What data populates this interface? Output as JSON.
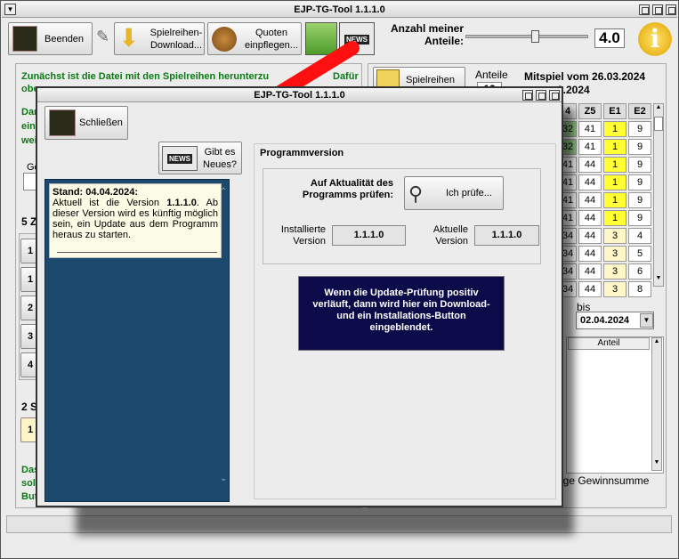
{
  "app": {
    "title": "EJP-TG-Tool 1.1.1.0"
  },
  "toolbar": {
    "quit_label": "Beenden",
    "download_label": "Spielreihen-\nDownload...",
    "quotes_label": "Quoten\neinpflegen...",
    "shares_label": "Anzahl meiner\nAnteile:",
    "shares_value": "4.0",
    "shares_slider": 0.55
  },
  "main": {
    "intro_text": "Zunächst ist die Datei mit den Spielreihen herunterzu",
    "intro_text2": "obe",
    "intro_tail": "Dafür",
    "intro2_lines": [
      "Dar",
      "ein",
      "wei"
    ],
    "ge_label": "Ge",
    "five_label": "5 Z",
    "rows": [
      "1",
      "1",
      "2",
      "3",
      "4"
    ],
    "two_label": "2 S",
    "two_row": "1",
    "bottom_lines": [
      "Das",
      "sola",
      "But"
    ],
    "spielreihen_label": "Spielreihen",
    "anteile_label": "Anteile",
    "anteile_value": "12",
    "mitspiel_label": "Mitspiel vom 26.03.2024",
    "mitspiel_to": "2.2024",
    "grid_headers": [
      "4",
      "Z5",
      "E1",
      "E2"
    ],
    "grid_rows": [
      [
        "32",
        "41",
        "1",
        "9"
      ],
      [
        "32",
        "41",
        "1",
        "9"
      ],
      [
        "41",
        "44",
        "1",
        "9"
      ],
      [
        "41",
        "44",
        "1",
        "9"
      ],
      [
        "41",
        "44",
        "1",
        "9"
      ],
      [
        "41",
        "44",
        "1",
        "9"
      ],
      [
        "34",
        "44",
        "3",
        "4"
      ],
      [
        "34",
        "44",
        "3",
        "5"
      ],
      [
        "34",
        "44",
        "3",
        "6"
      ],
      [
        "34",
        "44",
        "3",
        "8"
      ]
    ],
    "bis_label": "bis",
    "bis_date": "02.04.2024",
    "anteil_col": "Anteil",
    "gewinn_label": "ige Gewinnsumme"
  },
  "dialog": {
    "title": "EJP-TG-Tool 1.1.1.0",
    "close_label": "Schließen",
    "news_label": "Gibt es\nNeues?",
    "note_heading": "Stand: 04.04.2024:",
    "note_body_prefix": "Aktuell ist die Version ",
    "note_version": "1.1.1.0",
    "note_body": ". Ab dieser Version wird es künftig möglich sein, ein Update aus dem Programm heraus zu starten.",
    "group_label": "Programmversion",
    "check_label": "Auf Aktualität des\nProgramms prüfen:",
    "check_button": "Ich prüfe...",
    "installed_label": "Installierte\nVersion",
    "installed_value": "1.1.1.0",
    "current_label": "Aktuelle\nVersion",
    "current_value": "1.1.1.0",
    "info_text": "Wenn die Update-Prüfung positiv verläuft, dann wird hier ein Download- und ein Installations-Button eingeblendet."
  },
  "colors": {
    "accent_yellow": "#ffff33",
    "green_cell": "#98c98a",
    "title_green": "#0a7a14",
    "dark_blue": "#1c4a6e",
    "navy": "#0b0b4a",
    "red_arrow": "#ff1010"
  }
}
